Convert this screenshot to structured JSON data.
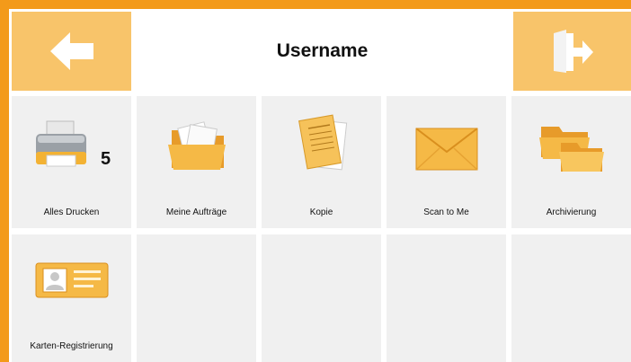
{
  "header": {
    "title": "Username",
    "back_icon": "arrow-left-icon",
    "logout_icon": "door-exit-icon"
  },
  "tiles": [
    {
      "label": "Alles Drucken",
      "icon": "printer-icon",
      "badge": "5"
    },
    {
      "label": "Meine Aufträge",
      "icon": "folder-documents-icon"
    },
    {
      "label": "Kopie",
      "icon": "document-copy-icon"
    },
    {
      "label": "Scan to Me",
      "icon": "envelope-icon"
    },
    {
      "label": "Archivierung",
      "icon": "folders-icon"
    },
    {
      "label": "Karten-Registrierung",
      "icon": "id-card-icon"
    }
  ],
  "colors": {
    "frame": "#f39a1a",
    "header_button": "#f8c46a",
    "tile_background": "#f0f0f0"
  }
}
